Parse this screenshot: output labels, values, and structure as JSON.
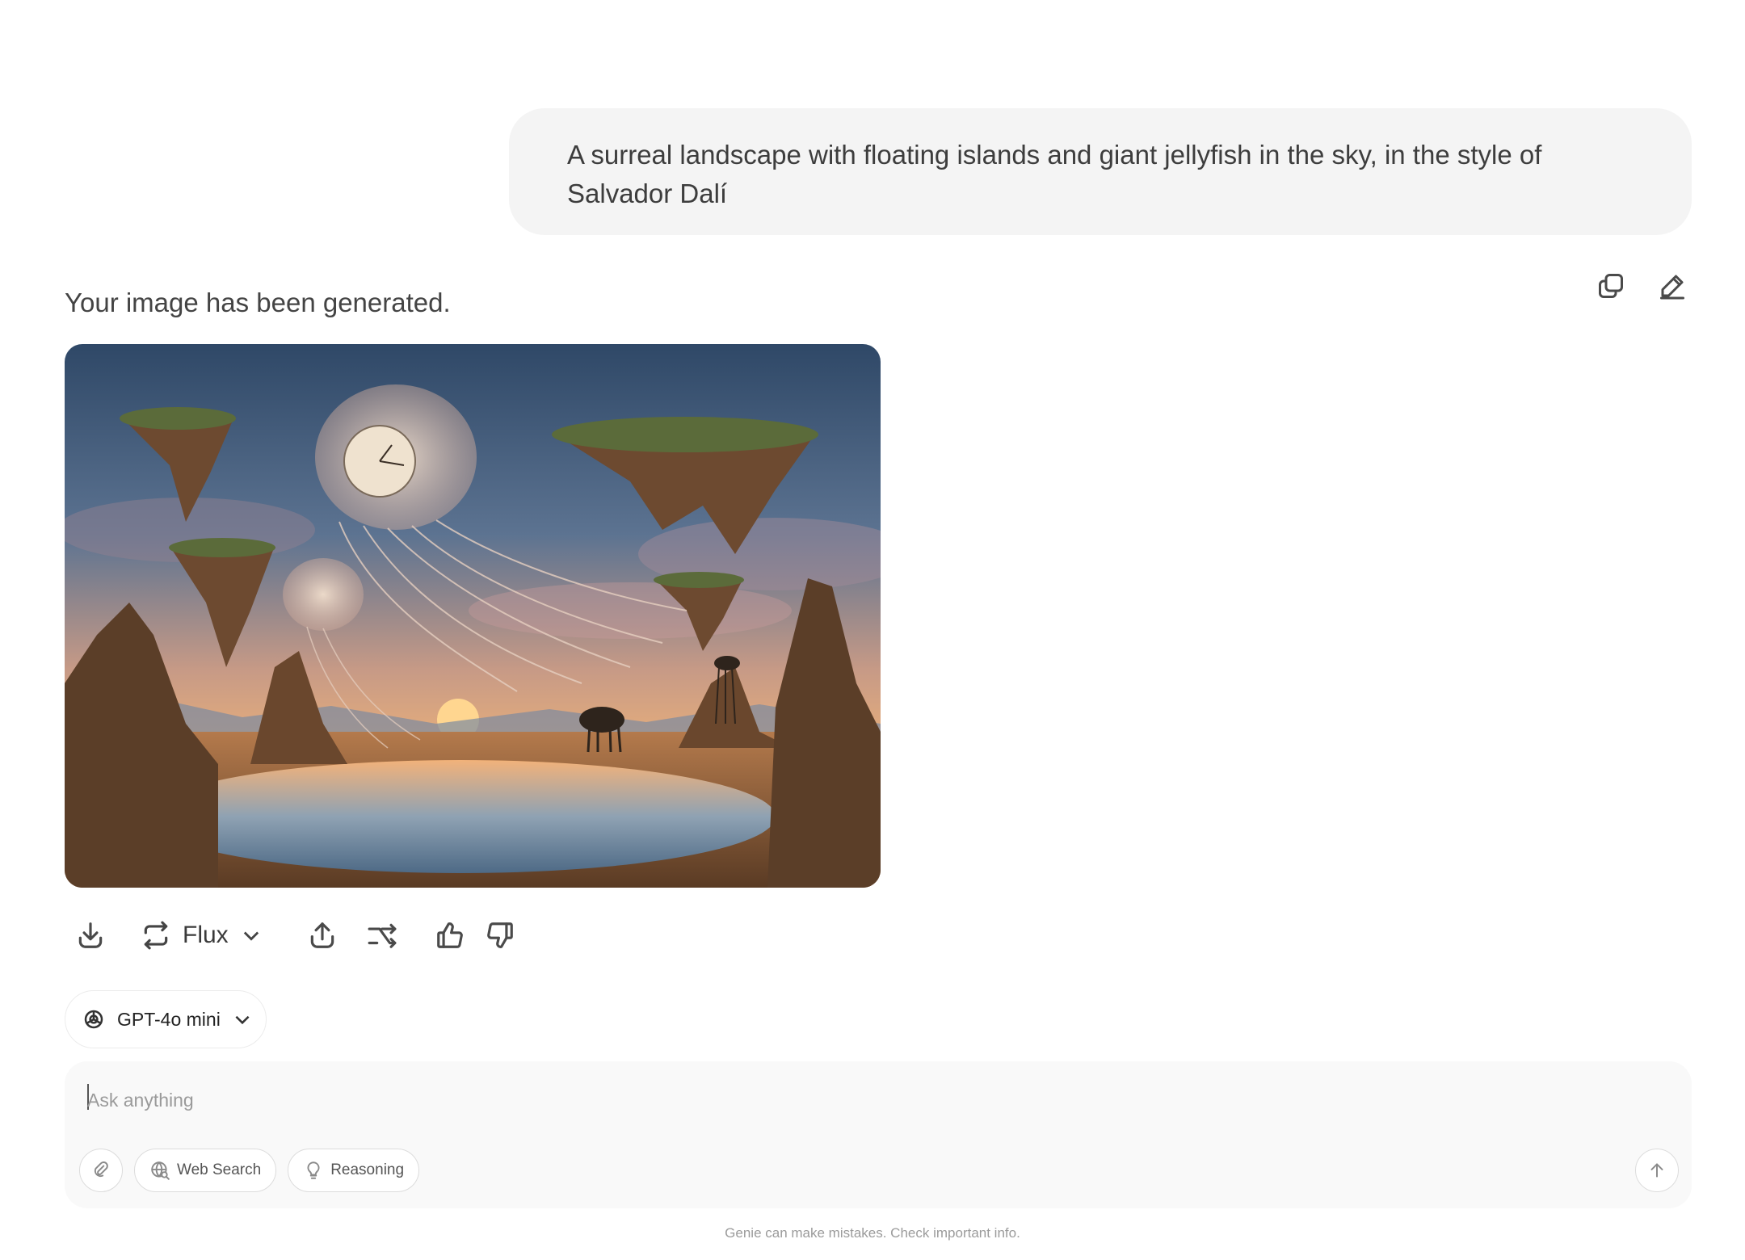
{
  "conversation": {
    "user_message": "A surreal landscape with floating islands and giant jellyfish in the sky, in the style of Salvador Dalí",
    "user_actions": {
      "copy_icon": "copy-icon",
      "edit_icon": "edit-pencil-icon"
    },
    "assistant_text": "Your image has been generated.",
    "image_toolbar": {
      "download_icon": "download-icon",
      "regenerate_icon": "regenerate-icon",
      "model_label": "Flux",
      "share_icon": "share-icon",
      "branch_icon": "branch-icon",
      "like_icon": "thumbs-up-icon",
      "dislike_icon": "thumbs-down-icon"
    }
  },
  "model_selector": {
    "label": "GPT-4o mini",
    "icon": "openai-icon"
  },
  "composer": {
    "placeholder": "Ask anything",
    "attach_icon": "attach-icon",
    "web_search_label": "Web Search",
    "reasoning_label": "Reasoning",
    "send_icon": "arrow-up-icon"
  },
  "footer": {
    "disclaimer": "Genie can make mistakes. Check important info."
  },
  "colors": {
    "bubble_bg": "#f4f4f4",
    "composer_bg": "#f9f9f9",
    "text": "#3a3a3a",
    "muted": "#9b9b9b"
  }
}
